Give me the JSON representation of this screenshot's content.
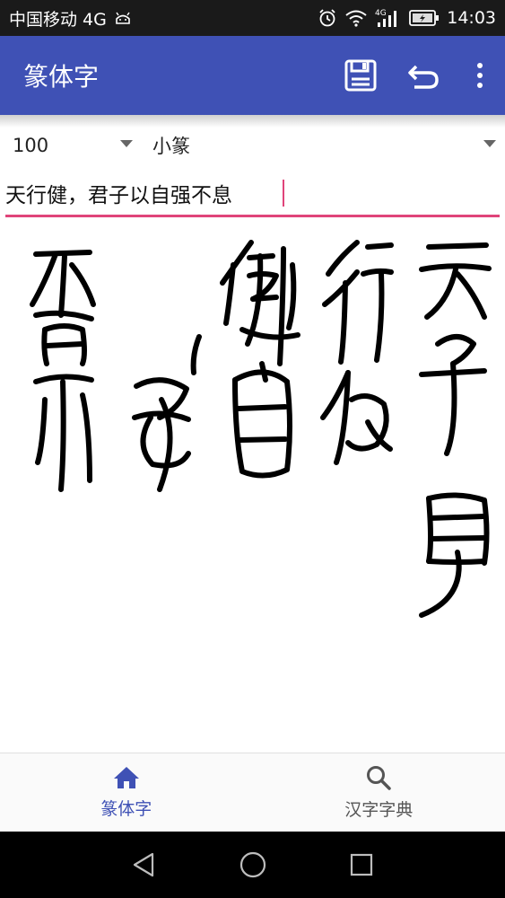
{
  "status_bar": {
    "carrier": "中国移动 4G",
    "time": "14:03",
    "network_label": "4G"
  },
  "app_bar": {
    "title": "篆体字",
    "icons": [
      "save-icon",
      "undo-icon",
      "more-vert-icon"
    ],
    "color": "#3f51b5"
  },
  "controls": {
    "size_value": "100",
    "font_value": "小篆",
    "input_text": "天行健，君子以自强不息"
  },
  "seal_columns": [
    "天子自",
    "行以",
    "健",
    "君强",
    "不息"
  ],
  "bottom_nav": {
    "items": [
      {
        "label": "篆体字",
        "icon": "home-icon",
        "active": true
      },
      {
        "label": "汉字字典",
        "icon": "search-icon",
        "active": false
      }
    ],
    "active_color": "#3f51b5"
  },
  "system_nav": {
    "icons": [
      "back-icon",
      "home-circle-icon",
      "recents-icon"
    ]
  },
  "accent_color": "#e0447a"
}
